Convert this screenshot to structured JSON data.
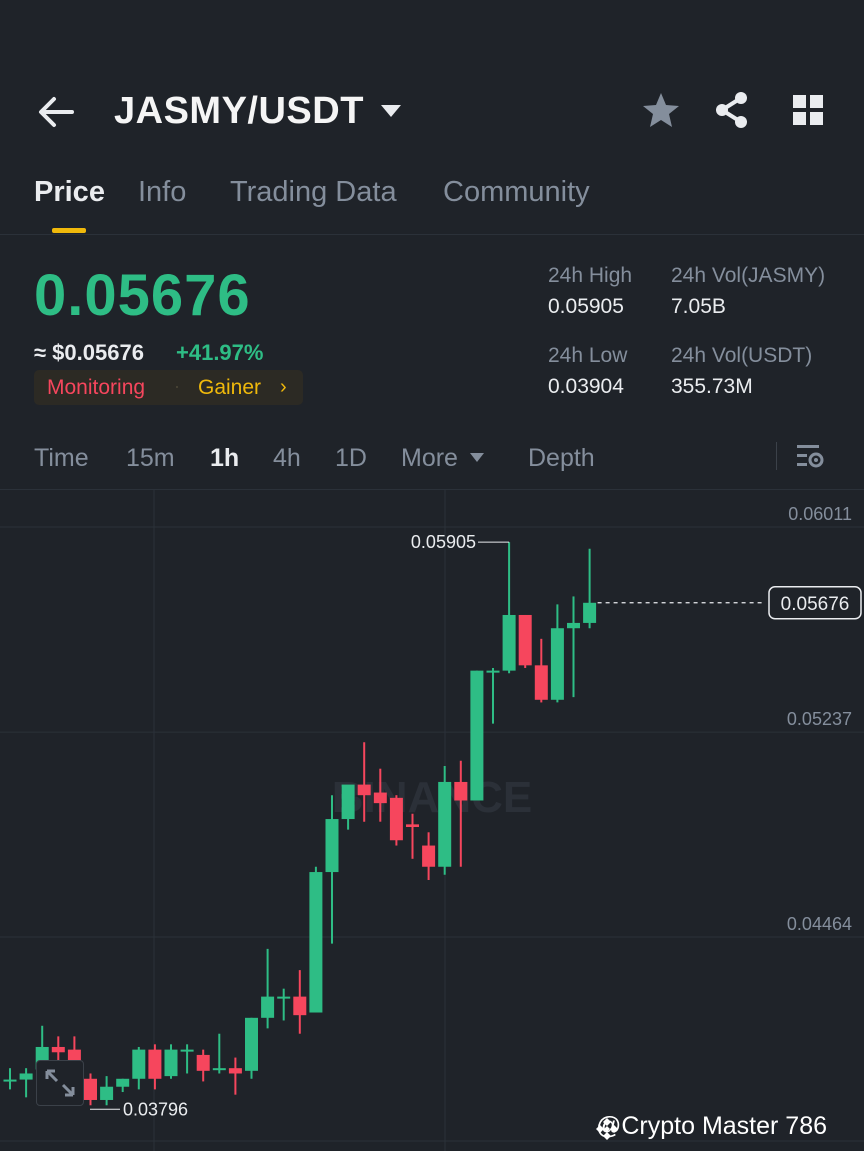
{
  "header": {
    "pair": "JASMY/USDT",
    "icons": [
      "back-arrow-icon",
      "caret-down-icon",
      "star-icon",
      "share-icon",
      "grid-menu-icon"
    ]
  },
  "tabs": [
    {
      "label": "Price",
      "active": true
    },
    {
      "label": "Info",
      "active": false
    },
    {
      "label": "Trading Data",
      "active": false
    },
    {
      "label": "Community",
      "active": false
    }
  ],
  "price": {
    "last": "0.05676",
    "usd": "≈ $0.05676",
    "change": "+41.97%",
    "tag_monitoring": "Monitoring",
    "tag_separator": "·",
    "tag_gainer": "Gainer",
    "tag_arrow": "›"
  },
  "stats": {
    "high_label": "24h High",
    "high_value": "0.05905",
    "low_label": "24h Low",
    "low_value": "0.03904",
    "vol_base_label": "24h Vol(JASMY)",
    "vol_base_value": "7.05B",
    "vol_quote_label": "24h Vol(USDT)",
    "vol_quote_value": "355.73M"
  },
  "timeframes": [
    {
      "label": "Time",
      "active": false
    },
    {
      "label": "15m",
      "active": false
    },
    {
      "label": "1h",
      "active": true
    },
    {
      "label": "4h",
      "active": false
    },
    {
      "label": "1D",
      "active": false
    },
    {
      "label": "More",
      "active": false
    },
    {
      "label": "Depth",
      "active": false
    }
  ],
  "colors": {
    "up": "#2ebd85",
    "down": "#f6465d",
    "accent": "#f0b90b",
    "background": "#1f2329"
  },
  "chart_data": {
    "type": "candlestick",
    "price_labels": [
      "0.06011",
      "0.05237",
      "0.04464"
    ],
    "current_price": "0.05676",
    "high_marker": "0.05905",
    "low_marker": "0.03796",
    "watermark": "BINANCE",
    "candles": [
      {
        "o": 0.03877,
        "h": 0.0392,
        "l": 0.0384,
        "c": 0.03877
      },
      {
        "o": 0.03877,
        "h": 0.0392,
        "l": 0.0381,
        "c": 0.039
      },
      {
        "o": 0.03915,
        "h": 0.0408,
        "l": 0.0388,
        "c": 0.04
      },
      {
        "o": 0.04,
        "h": 0.0404,
        "l": 0.0389,
        "c": 0.0398
      },
      {
        "o": 0.0399,
        "h": 0.0404,
        "l": 0.0388,
        "c": 0.039
      },
      {
        "o": 0.0388,
        "h": 0.039,
        "l": 0.0378,
        "c": 0.038
      },
      {
        "o": 0.038,
        "h": 0.0389,
        "l": 0.0378,
        "c": 0.0385
      },
      {
        "o": 0.0385,
        "h": 0.0388,
        "l": 0.0383,
        "c": 0.0388
      },
      {
        "o": 0.0388,
        "h": 0.04,
        "l": 0.0384,
        "c": 0.0399
      },
      {
        "o": 0.0399,
        "h": 0.0401,
        "l": 0.0384,
        "c": 0.0388
      },
      {
        "o": 0.0389,
        "h": 0.0401,
        "l": 0.0388,
        "c": 0.0399
      },
      {
        "o": 0.0399,
        "h": 0.0401,
        "l": 0.039,
        "c": 0.0399
      },
      {
        "o": 0.0397,
        "h": 0.0399,
        "l": 0.0387,
        "c": 0.0391
      },
      {
        "o": 0.0392,
        "h": 0.0405,
        "l": 0.039,
        "c": 0.0392
      },
      {
        "o": 0.0392,
        "h": 0.0396,
        "l": 0.0382,
        "c": 0.039
      },
      {
        "o": 0.0391,
        "h": 0.0411,
        "l": 0.0388,
        "c": 0.0411
      },
      {
        "o": 0.0411,
        "h": 0.0437,
        "l": 0.0407,
        "c": 0.0419
      },
      {
        "o": 0.0419,
        "h": 0.0422,
        "l": 0.041,
        "c": 0.0419
      },
      {
        "o": 0.0419,
        "h": 0.0429,
        "l": 0.0405,
        "c": 0.0412
      },
      {
        "o": 0.0413,
        "h": 0.0468,
        "l": 0.0413,
        "c": 0.0466
      },
      {
        "o": 0.0466,
        "h": 0.0495,
        "l": 0.0439,
        "c": 0.0486
      },
      {
        "o": 0.0486,
        "h": 0.0497,
        "l": 0.0482,
        "c": 0.0499
      },
      {
        "o": 0.0499,
        "h": 0.0515,
        "l": 0.0485,
        "c": 0.0495
      },
      {
        "o": 0.0496,
        "h": 0.0505,
        "l": 0.0485,
        "c": 0.0492
      },
      {
        "o": 0.0494,
        "h": 0.0495,
        "l": 0.0476,
        "c": 0.0478
      },
      {
        "o": 0.0484,
        "h": 0.0488,
        "l": 0.0471,
        "c": 0.0483
      },
      {
        "o": 0.0476,
        "h": 0.0481,
        "l": 0.0463,
        "c": 0.0468
      },
      {
        "o": 0.0468,
        "h": 0.0506,
        "l": 0.0465,
        "c": 0.05
      },
      {
        "o": 0.05,
        "h": 0.0508,
        "l": 0.0468,
        "c": 0.0493
      },
      {
        "o": 0.0493,
        "h": 0.0542,
        "l": 0.0493,
        "c": 0.0542
      },
      {
        "o": 0.0542,
        "h": 0.0543,
        "l": 0.0522,
        "c": 0.0542
      },
      {
        "o": 0.0542,
        "h": 0.05905,
        "l": 0.0541,
        "c": 0.0563
      },
      {
        "o": 0.0563,
        "h": 0.0563,
        "l": 0.0543,
        "c": 0.0544
      },
      {
        "o": 0.0544,
        "h": 0.0554,
        "l": 0.053,
        "c": 0.0531
      },
      {
        "o": 0.0531,
        "h": 0.0567,
        "l": 0.053,
        "c": 0.0558
      },
      {
        "o": 0.0558,
        "h": 0.057,
        "l": 0.0532,
        "c": 0.056
      },
      {
        "o": 0.056,
        "h": 0.0588,
        "l": 0.0558,
        "c": 0.05676
      }
    ]
  },
  "watermark_text": "@Crypto Master 786"
}
